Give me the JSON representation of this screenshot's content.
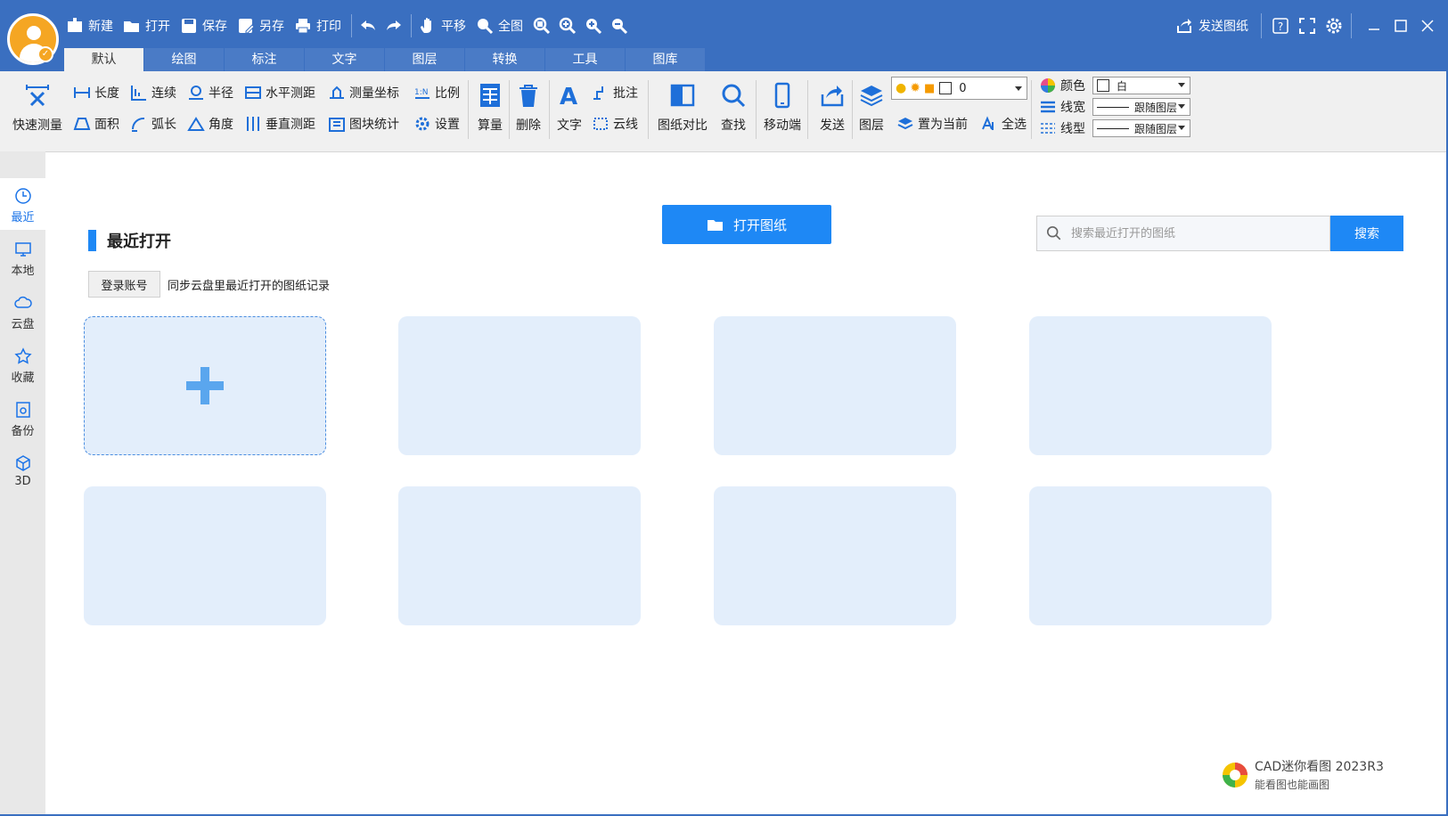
{
  "titlebar": {
    "quick": {
      "new": "新建",
      "open": "打开",
      "save": "保存",
      "save_as": "另存",
      "print": "打印",
      "pan": "平移",
      "fit": "全图"
    },
    "send_drawing": "发送图纸"
  },
  "tabs": [
    "默认",
    "绘图",
    "标注",
    "文字",
    "图层",
    "转换",
    "工具",
    "图库"
  ],
  "ribbon": {
    "quick_measure": "快速测量",
    "length": "长度",
    "continuous": "连续",
    "radius": "半径",
    "horizontal_measure": "水平测距",
    "measure_coord": "测量坐标",
    "ratio": "比例",
    "area": "面积",
    "arc_length": "弧长",
    "angle": "角度",
    "vertical_measure": "垂直测距",
    "block_stats": "图块统计",
    "settings": "设置",
    "calc": "算量",
    "delete": "删除",
    "text": "文字",
    "annotate": "批注",
    "cloud_line": "云线",
    "compare": "图纸对比",
    "find": "查找",
    "mobile": "移动端",
    "send": "发送",
    "layer": "图层",
    "set_current": "置为当前",
    "select_all": "全选",
    "layer_value": "0",
    "color_label": "颜色",
    "color_value": "白",
    "linewidth_label": "线宽",
    "linewidth_value": "跟随图层",
    "linetype_label": "线型",
    "linetype_value": "跟随图层"
  },
  "sidebar": [
    "最近",
    "本地",
    "云盘",
    "收藏",
    "备份",
    "3D"
  ],
  "main": {
    "open_button": "打开图纸",
    "section_title": "最近打开",
    "login_button": "登录账号",
    "sync_note": "同步云盘里最近打开的图纸记录",
    "search_placeholder": "搜索最近打开的图纸",
    "search_button": "搜索"
  },
  "brand": {
    "name": "CAD迷你看图 2023R3",
    "slogan": "能看图也能画图"
  },
  "colors": {
    "title_blue": "#3a6fc0",
    "accent": "#1e88f5",
    "card_bg": "#e3eefb",
    "ribbon_bg": "#f0f0f0"
  }
}
